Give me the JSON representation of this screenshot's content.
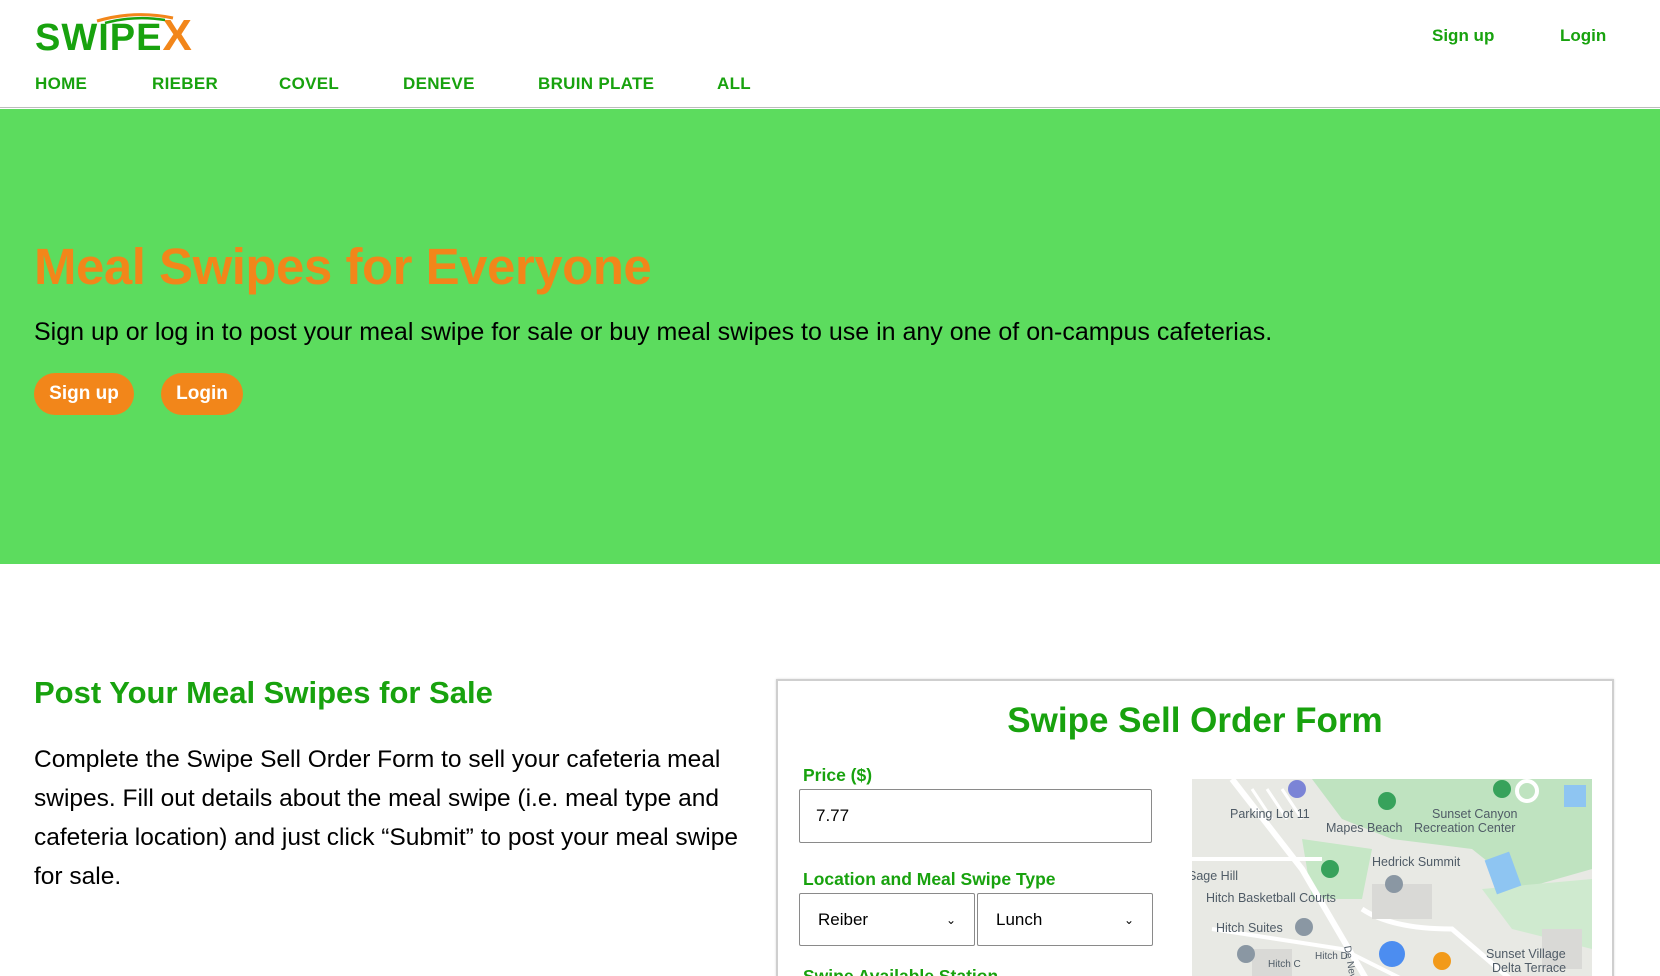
{
  "brand": {
    "logo_main": "SWIPE",
    "logo_accent": "X",
    "colors": {
      "green": "#18a20e",
      "orange": "#f2861a",
      "hero_bg": "#5cdc5e"
    }
  },
  "header": {
    "signup": "Sign up",
    "login": "Login",
    "nav": [
      "HOME",
      "RIEBER",
      "COVEL",
      "DENEVE",
      "BRUIN PLATE",
      "ALL"
    ]
  },
  "hero": {
    "title": "Meal Swipes for Everyone",
    "subtitle": "Sign up or log in to post your meal swipe for sale or buy meal swipes to use in any one of on-campus cafeterias.",
    "signup_button": "Sign up",
    "login_button": "Login"
  },
  "post": {
    "title": "Post Your Meal Swipes for Sale",
    "description": "Complete the Swipe Sell Order Form to sell your cafeteria meal swipes. Fill out details about the meal swipe (i.e. meal type and cafeteria location) and just click “Submit” to post your meal swipe for sale."
  },
  "form": {
    "title": "Swipe Sell Order Form",
    "price_label": "Price ($)",
    "price_value": "7.77",
    "location_label": "Location and Meal Swipe Type",
    "location_selected": "Reiber",
    "meal_selected": "Lunch",
    "next_label_partial": "Swipe Available Station"
  },
  "map": {
    "labels": [
      "Parking Lot 11",
      "Sunset Canyon",
      "Mapes Beach",
      "Recreation Center",
      "Hedrick Summit",
      "Sage Hill",
      "Hitch Basketball Courts",
      "Hitch Suites",
      "Hitch C",
      "Hitch D",
      "De Neve",
      "Sunset Village",
      "Delta Terrace"
    ]
  }
}
